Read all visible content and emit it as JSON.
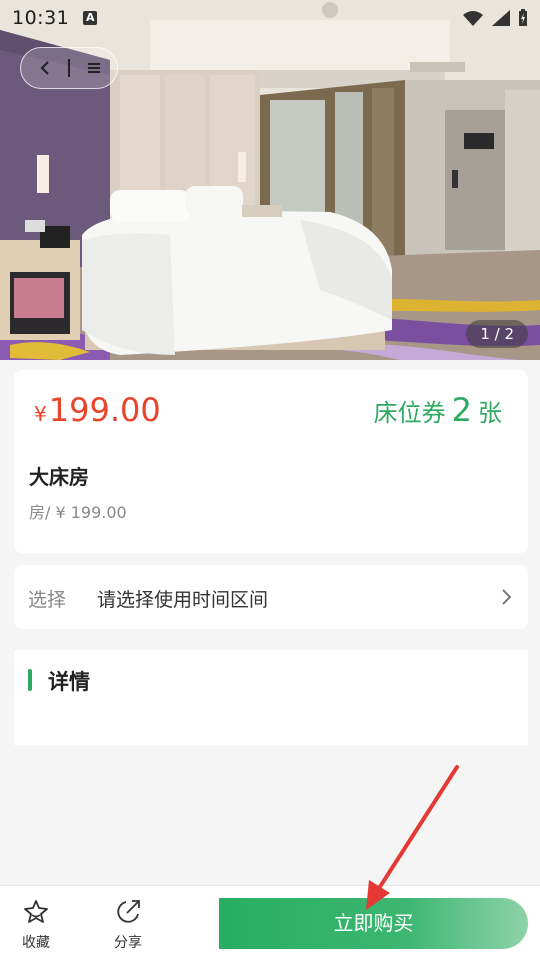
{
  "status_bar": {
    "time": "10:31",
    "notification_icon": "A"
  },
  "hero": {
    "pager": "1 / 2"
  },
  "price_card": {
    "currency": "¥",
    "price": "199.00",
    "voucher_label": "床位券",
    "voucher_count": "2",
    "voucher_unit": "张",
    "room_name": "大床房",
    "room_price": "房/ ¥ 199.00"
  },
  "select_row": {
    "label": "选择",
    "value": "请选择使用时间区间"
  },
  "detail": {
    "title": "详情"
  },
  "bottom_bar": {
    "favorite_label": "收藏",
    "share_label": "分享",
    "buy_label": "立即购买"
  },
  "colors": {
    "accent_green": "#2faa62",
    "price_red": "#e8442a",
    "annotation_arrow": "#e53935"
  }
}
